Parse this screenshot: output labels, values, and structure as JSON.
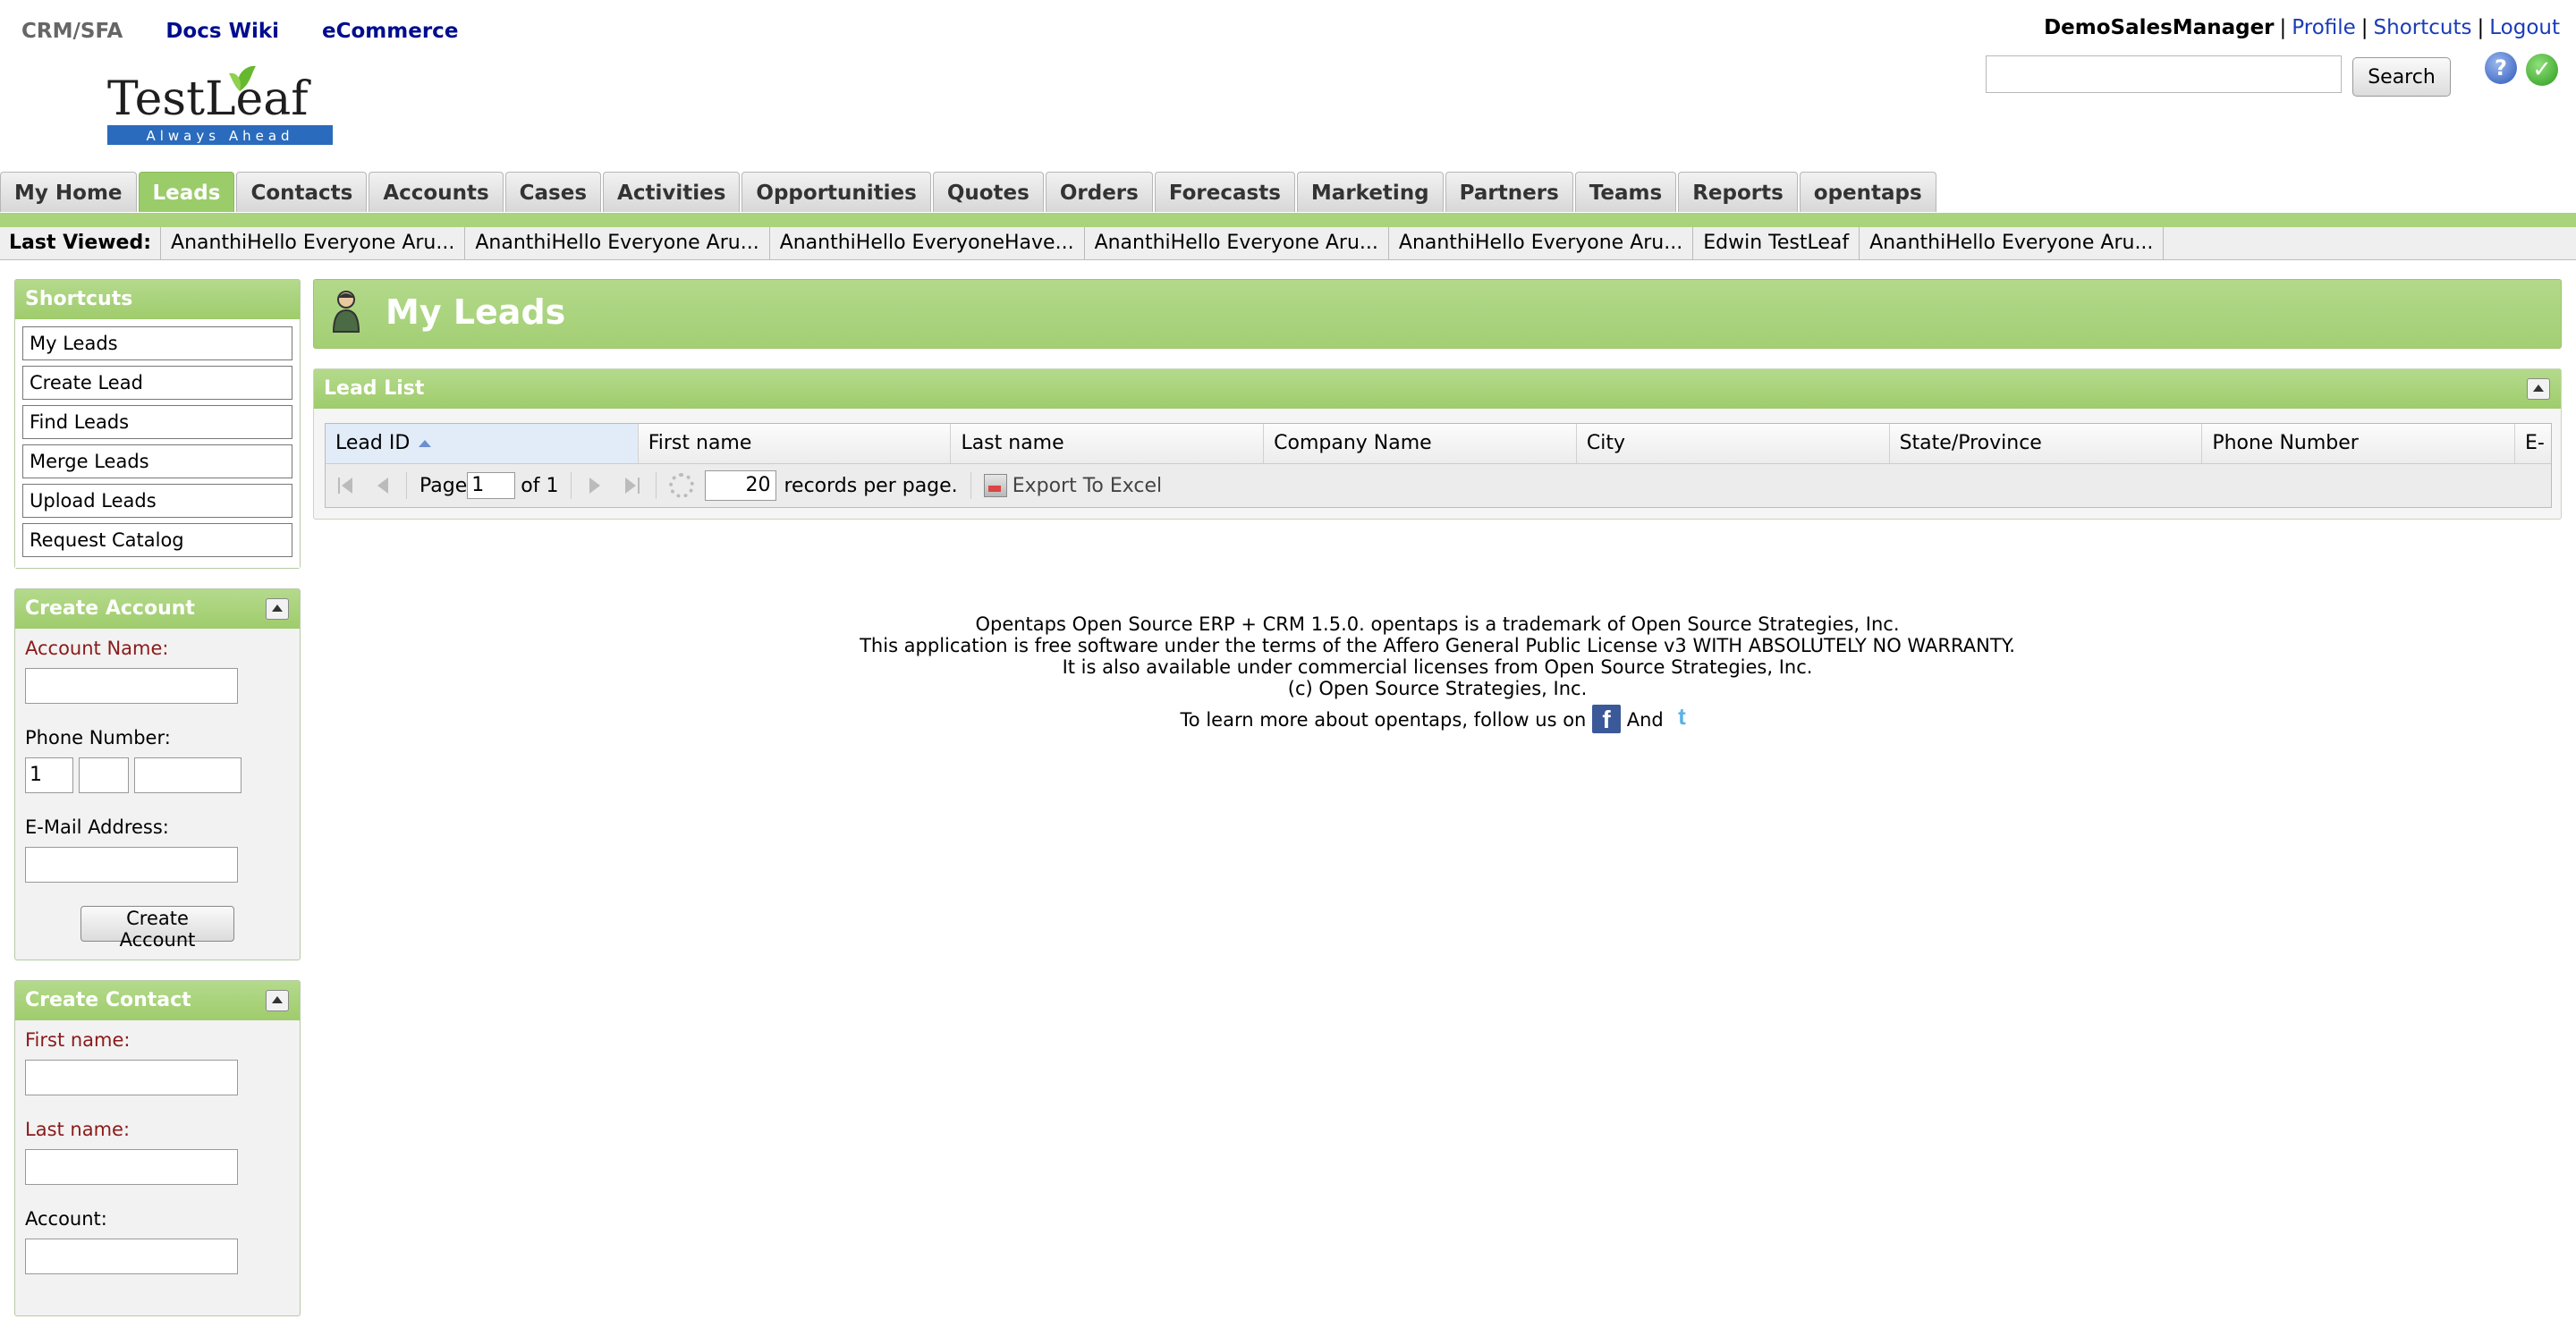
{
  "app_links": {
    "current": "CRM/SFA",
    "docs": "Docs Wiki",
    "ecommerce": "eCommerce"
  },
  "logo": {
    "brand": "TestLeaf",
    "tagline": "Always Ahead"
  },
  "user": {
    "name": "DemoSalesManager",
    "profile": "Profile",
    "shortcuts": "Shortcuts",
    "logout": "Logout",
    "separator": "|"
  },
  "search": {
    "button": "Search",
    "placeholder": ""
  },
  "icons": {
    "help": "?",
    "ok": "✓"
  },
  "tabs": [
    "My Home",
    "Leads",
    "Contacts",
    "Accounts",
    "Cases",
    "Activities",
    "Opportunities",
    "Quotes",
    "Orders",
    "Forecasts",
    "Marketing",
    "Partners",
    "Teams",
    "Reports",
    "opentaps"
  ],
  "active_tab": "Leads",
  "last_viewed": {
    "label": "Last Viewed:",
    "items": [
      "AnanthiHello Everyone Aru...",
      "AnanthiHello Everyone Aru...",
      "AnanthiHello EveryoneHave...",
      "AnanthiHello Everyone Aru...",
      "AnanthiHello Everyone Aru...",
      "Edwin TestLeaf",
      "AnanthiHello Everyone Aru..."
    ]
  },
  "shortcuts": {
    "title": "Shortcuts",
    "items": [
      "My Leads",
      "Create Lead",
      "Find Leads",
      "Merge Leads",
      "Upload Leads",
      "Request Catalog"
    ]
  },
  "create_account": {
    "title": "Create Account",
    "account_name_label": "Account Name:",
    "phone_label": "Phone Number:",
    "phone_country_code": "1",
    "email_label": "E-Mail Address:",
    "button": "Create Account"
  },
  "create_contact": {
    "title": "Create Contact",
    "first_name_label": "First name:",
    "last_name_label": "Last name:",
    "account_label": "Account:"
  },
  "page": {
    "title": "My Leads"
  },
  "lead_list": {
    "title": "Lead List",
    "columns": [
      "Lead ID",
      "First name",
      "Last name",
      "Company Name",
      "City",
      "State/Province",
      "Phone Number",
      "E-"
    ],
    "sorted_column": "Lead ID",
    "pager": {
      "page_label": "Page",
      "page_value": "1",
      "of_label": "of 1",
      "per_page_value": "20",
      "per_page_label": "records per page.",
      "export": "Export To Excel"
    }
  },
  "footer": {
    "line1": "Opentaps Open Source ERP + CRM 1.5.0. opentaps is a trademark of Open Source Strategies, Inc.",
    "line2": "This application is free software under the terms of the Affero General Public License v3 WITH ABSOLUTELY NO WARRANTY.",
    "line3": "It is also available under commercial licenses from Open Source Strategies, Inc.",
    "line4": "(c) Open Source Strategies, Inc.",
    "follow": "To learn more about opentaps, follow us on",
    "and": "And",
    "facebook_glyph": "f",
    "twitter_glyph": "t"
  },
  "colors": {
    "accent_green": "#a3cf74",
    "link_blue": "#1a3cb8",
    "required_red": "#8b1a1a"
  }
}
